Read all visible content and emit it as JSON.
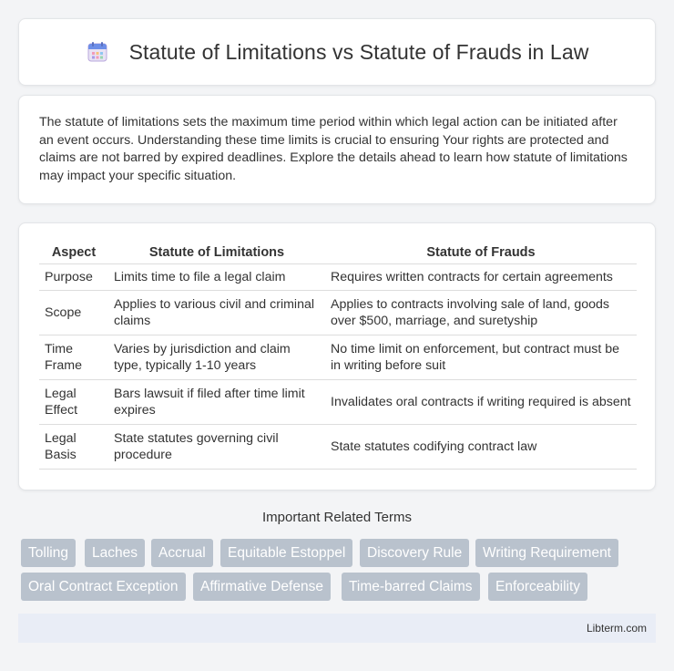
{
  "header": {
    "title": "Statute of Limitations vs Statute of Frauds in Law",
    "icon": "calendar-icon"
  },
  "intro": {
    "text": "The statute of limitations sets the maximum time period within which legal action can be initiated after an event occurs. Understanding these time limits is crucial to ensuring Your rights are protected and claims are not barred by expired deadlines. Explore the details ahead to learn how statute of limitations may impact your specific situation."
  },
  "table": {
    "headers": [
      "Aspect",
      "Statute of Limitations",
      "Statute of Frauds"
    ],
    "rows": [
      [
        "Purpose",
        "Limits time to file a legal claim",
        "Requires written contracts for certain agreements"
      ],
      [
        "Scope",
        "Applies to various civil and criminal claims",
        "Applies to contracts involving sale of land, goods over $500, marriage, and suretyship"
      ],
      [
        "Time Frame",
        "Varies by jurisdiction and claim type, typically 1-10 years",
        "No time limit on enforcement, but contract must be in writing before suit"
      ],
      [
        "Legal Effect",
        "Bars lawsuit if filed after time limit expires",
        "Invalidates oral contracts if writing required is absent"
      ],
      [
        "Legal Basis",
        "State statutes governing civil procedure",
        "State statutes codifying contract law"
      ]
    ]
  },
  "related": {
    "title": "Important Related Terms",
    "tags": [
      "Tolling",
      "Laches",
      "Accrual",
      "Equitable Estoppel",
      "Discovery Rule",
      "Writing Requirement",
      "Oral Contract Exception",
      "Affirmative Defense",
      "Time-barred Claims",
      "Enforceability"
    ]
  },
  "footer": {
    "site": "Libterm.com"
  },
  "colors": {
    "tag_background": "#b9c2cd",
    "footer_background": "#e9edf6"
  }
}
